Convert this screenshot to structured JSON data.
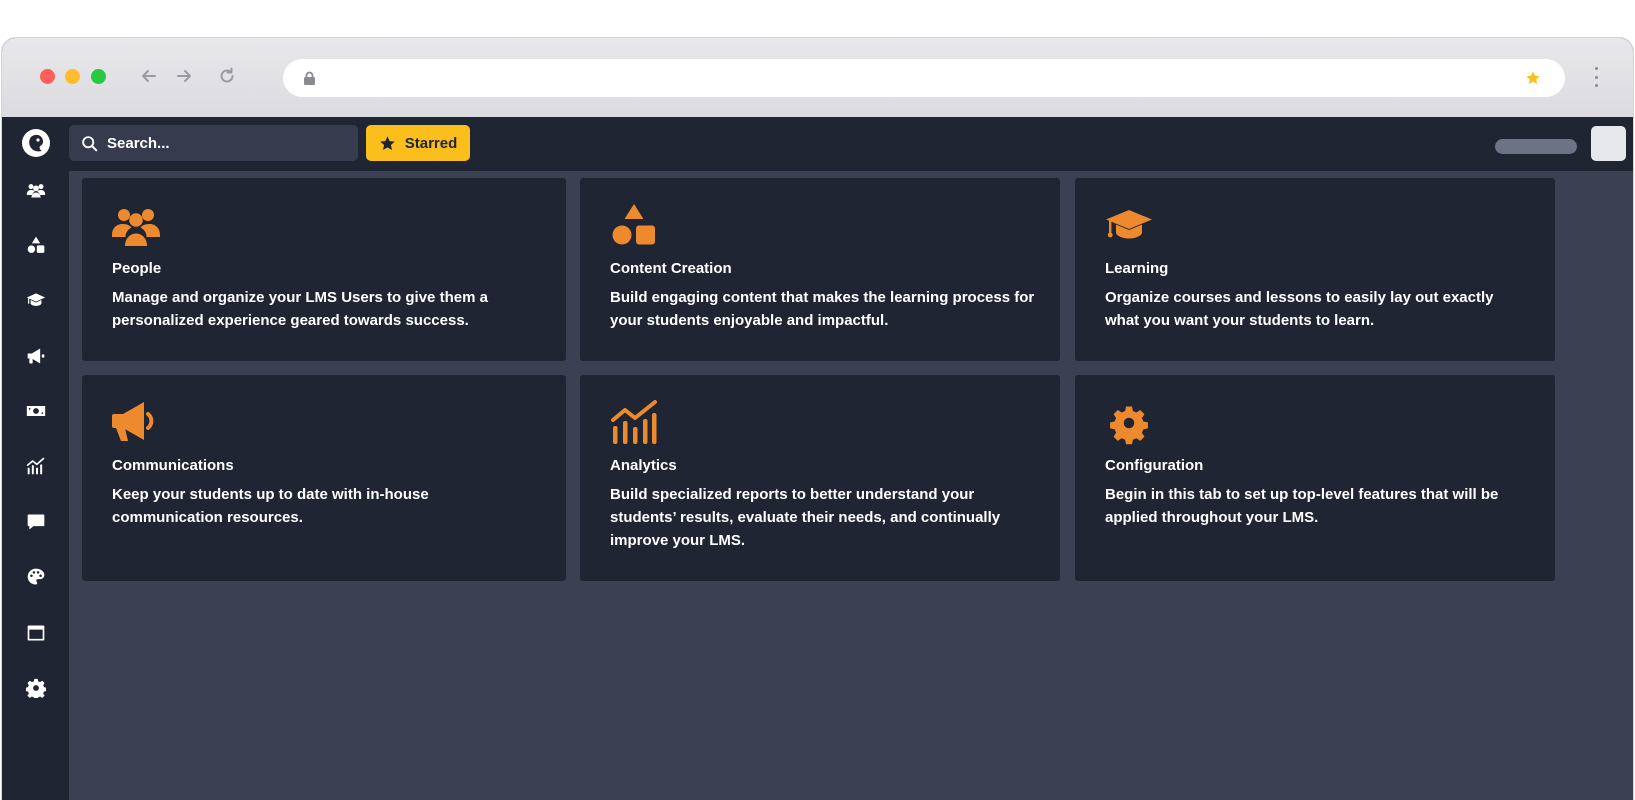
{
  "browser": {
    "url": "",
    "icons": [
      "back-arrow-icon",
      "forward-arrow-icon",
      "reload-icon",
      "lock-icon",
      "bookmark-star-icon",
      "more-vertical-icon"
    ]
  },
  "topbar": {
    "search_placeholder": "Search...",
    "starred_label": "Starred"
  },
  "sidebar": {
    "items": [
      {
        "icon": "people-icon"
      },
      {
        "icon": "shapes-icon"
      },
      {
        "icon": "graduation-cap-icon"
      },
      {
        "icon": "megaphone-icon"
      },
      {
        "icon": "money-icon"
      },
      {
        "icon": "analytics-icon"
      },
      {
        "icon": "chat-icon"
      },
      {
        "icon": "palette-icon"
      },
      {
        "icon": "window-icon"
      },
      {
        "icon": "gear-icon"
      }
    ]
  },
  "colors": {
    "accent": "#ee8a2e",
    "starred": "#fbbf1d",
    "panel": "#1f2532",
    "background": "#3b4152"
  },
  "cards": [
    {
      "icon": "people-icon",
      "title": "People",
      "description": "Manage and organize your LMS Users to give them a personalized experience geared towards success."
    },
    {
      "icon": "shapes-icon",
      "title": "Content Creation",
      "description": "Build engaging content that makes the learning process for your students enjoyable and impactful."
    },
    {
      "icon": "graduation-cap-icon",
      "title": "Learning",
      "description": "Organize courses and lessons to easily lay out exactly what you want your students to learn."
    },
    {
      "icon": "megaphone-icon",
      "title": "Communications",
      "description": "Keep your students up to date with in-house communication resources."
    },
    {
      "icon": "analytics-icon",
      "title": "Analytics",
      "description": "Build specialized reports to better understand your students’ results, evaluate their needs, and continually improve your LMS."
    },
    {
      "icon": "gear-icon",
      "title": "Configuration",
      "description": "Begin in this tab to set up top-level features that will be applied throughout your LMS."
    }
  ]
}
